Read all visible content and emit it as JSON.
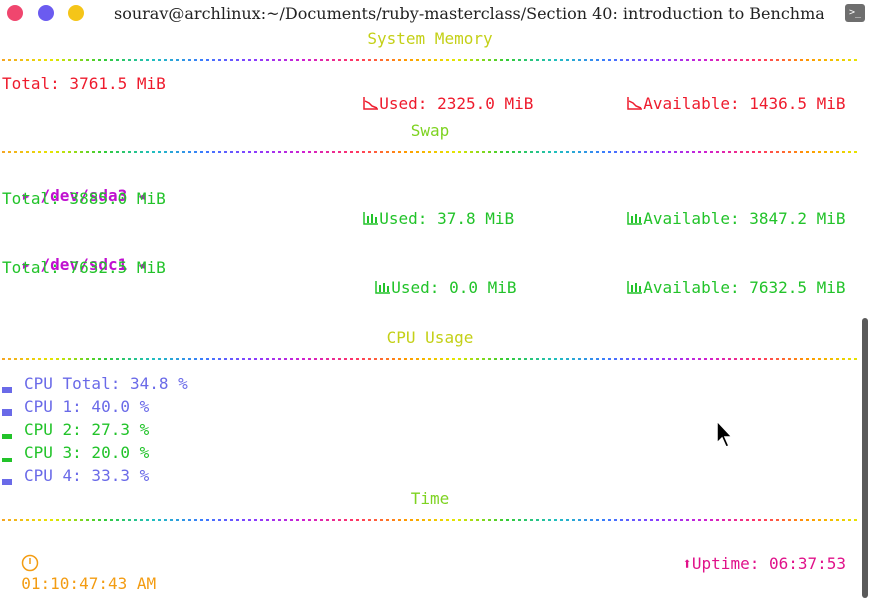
{
  "window": {
    "title": "sourav@archlinux:~/Documents/ruby-masterclass/Section 40: introduction to Benchma",
    "terminal_icon": ">_"
  },
  "memory": {
    "heading": "System Memory",
    "total": "Total: 3761.5 MiB",
    "used": "Used: 2325.0 MiB",
    "available": "Available: 1436.5 MiB"
  },
  "swap": {
    "heading": "Swap",
    "devices": [
      {
        "name": "/dev/sda3",
        "total": "Total: 3885.0 MiB",
        "used": "Used: 37.8 MiB",
        "available": "Available: 3847.2 MiB"
      },
      {
        "name": "/dev/sdc1",
        "total": "Total: 7632.5 MiB",
        "used": "Used: 0.0 MiB",
        "available": "Available: 7632.5 MiB"
      }
    ]
  },
  "cpu": {
    "heading": "CPU Usage",
    "rows": [
      {
        "label": "CPU Total: 34.8 %",
        "level": 34.8,
        "color": "#6a6ae8"
      },
      {
        "label": "CPU 1: 40.0 %",
        "level": 40.0,
        "color": "#6a6ae8"
      },
      {
        "label": "CPU 2: 27.3 %",
        "level": 27.3,
        "color": "#22c32a"
      },
      {
        "label": "CPU 3: 20.0 %",
        "level": 20.0,
        "color": "#22c32a"
      },
      {
        "label": "CPU 4: 33.3 %",
        "level": 33.3,
        "color": "#6a6ae8"
      }
    ]
  },
  "time": {
    "heading": "Time",
    "clock": "01:10:47:43 AM",
    "uptime": "Uptime: 06:37:53"
  }
}
